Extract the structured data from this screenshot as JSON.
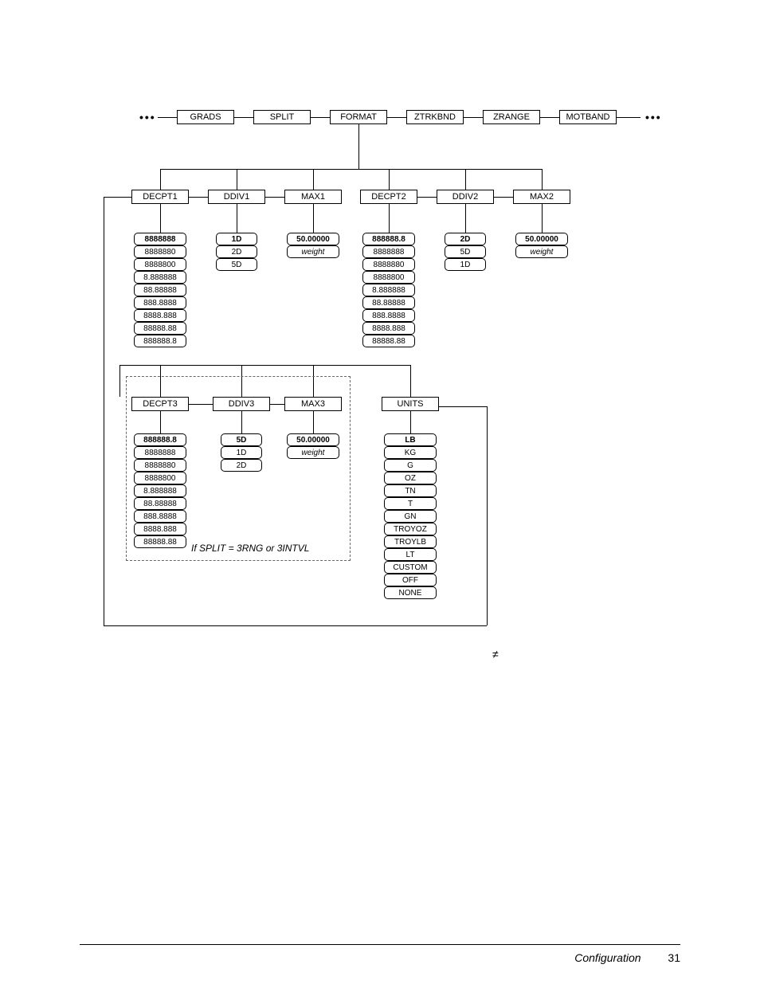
{
  "top_row": {
    "items": [
      "GRADS",
      "SPLIT",
      "FORMAT",
      "ZTRKBND",
      "ZRANGE",
      "MOTBAND"
    ]
  },
  "row2": {
    "items": [
      "DECPT1",
      "DDIV1",
      "MAX1",
      "DECPT2",
      "DDIV2",
      "MAX2"
    ]
  },
  "decpt1_opts": [
    "8888888",
    "8888880",
    "8888800",
    "8.888888",
    "88.88888",
    "888.8888",
    "8888.888",
    "88888.88",
    "888888.8"
  ],
  "decpt1_bold_index": 0,
  "ddiv1_opts": [
    "1D",
    "2D",
    "5D"
  ],
  "ddiv1_bold_index": 0,
  "max1_opts": [
    "50.00000",
    "weight"
  ],
  "max1_bold_index": 0,
  "decpt2_opts": [
    "888888.8",
    "8888888",
    "8888880",
    "8888800",
    "8.888888",
    "88.88888",
    "888.8888",
    "8888.888",
    "88888.88"
  ],
  "decpt2_bold_index": 0,
  "ddiv2_opts": [
    "2D",
    "5D",
    "1D"
  ],
  "ddiv2_bold_index": 0,
  "max2_opts": [
    "50.00000",
    "weight"
  ],
  "max2_bold_index": 0,
  "row3": {
    "items": [
      "DECPT3",
      "DDIV3",
      "MAX3",
      "UNITS"
    ]
  },
  "decpt3_opts": [
    "888888.8",
    "8888888",
    "8888880",
    "8888800",
    "8.888888",
    "88.88888",
    "888.8888",
    "8888.888",
    "88888.88"
  ],
  "decpt3_bold_index": 0,
  "ddiv3_opts": [
    "5D",
    "1D",
    "2D"
  ],
  "ddiv3_bold_index": 0,
  "max3_opts": [
    "50.00000",
    "weight"
  ],
  "max3_bold_index": 0,
  "units_opts": [
    "LB",
    "KG",
    "G",
    "OZ",
    "TN",
    "T",
    "GN",
    "TROYOZ",
    "TROYLB",
    "LT",
    "CUSTOM",
    "OFF",
    "NONE"
  ],
  "units_bold_index": 0,
  "split_note": "If SPLIT = 3RNG or 3INTVL",
  "neq_symbol": "≠",
  "footer": {
    "title": "Configuration",
    "page": "31"
  }
}
